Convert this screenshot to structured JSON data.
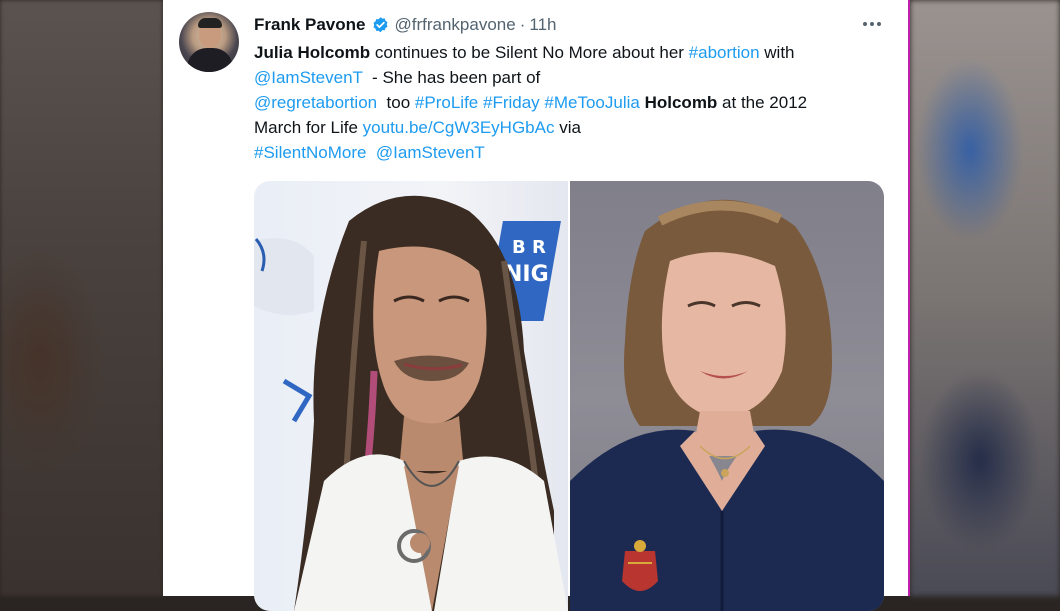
{
  "tweet": {
    "author_name": "Frank Pavone",
    "handle": "@frfrankpavone",
    "separator": "·",
    "time": "11h",
    "text_lines": [
      [
        {
          "t": "Julia Holcomb",
          "s": "bold"
        },
        {
          "t": " continues to be Silent No More about her ",
          "s": "plain"
        },
        {
          "t": "#abortion",
          "s": "link"
        },
        {
          "t": " with",
          "s": "plain"
        }
      ],
      [
        {
          "t": "@IamStevenT",
          "s": "link"
        },
        {
          "t": "  - She has been part of",
          "s": "plain"
        }
      ],
      [
        {
          "t": "@regretabortion",
          "s": "link"
        },
        {
          "t": "  too ",
          "s": "plain"
        },
        {
          "t": "#ProLife",
          "s": "link"
        },
        {
          "t": " ",
          "s": "plain"
        },
        {
          "t": "#Friday",
          "s": "link"
        },
        {
          "t": " ",
          "s": "plain"
        },
        {
          "t": "#MeTooJulia",
          "s": "link"
        },
        {
          "t": " ",
          "s": "plain"
        },
        {
          "t": "Holcomb",
          "s": "bold"
        },
        {
          "t": " at the 2012",
          "s": "plain"
        }
      ],
      [
        {
          "t": "March for Life ",
          "s": "plain"
        },
        {
          "t": "youtu.be/CgW3EyHGbAc",
          "s": "link"
        },
        {
          "t": " via",
          "s": "plain"
        }
      ],
      [
        {
          "t": "#SilentNoMore",
          "s": "link"
        },
        {
          "t": "  ",
          "s": "plain"
        },
        {
          "t": "@IamStevenT",
          "s": "link"
        }
      ]
    ]
  },
  "icons": {
    "verified": "verified-badge-icon",
    "more": "more-options-icon"
  },
  "colors": {
    "link": "#1d9bf0",
    "text": "#0f1419",
    "secondary": "#536471",
    "verified": "#1d9bf0",
    "card_border": "#c21fb0"
  }
}
